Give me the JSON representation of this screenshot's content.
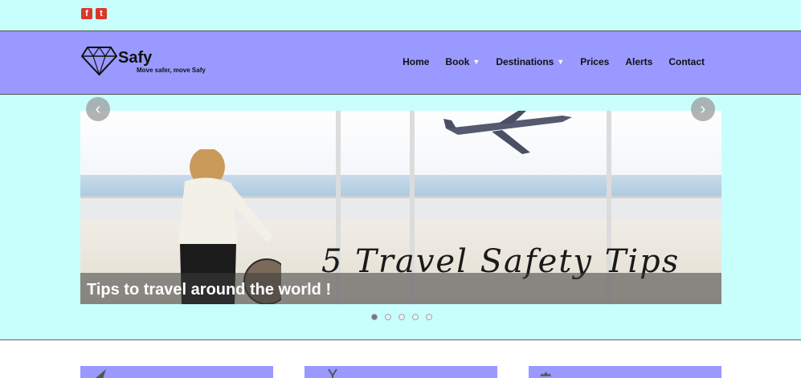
{
  "social": {
    "facebook_glyph": "f",
    "twitter_glyph": "t"
  },
  "brand": {
    "name": "Safy",
    "tagline": "Move safer, move Safy",
    "icon": "diamond-icon"
  },
  "nav": {
    "items": [
      {
        "label": "Home",
        "dropdown": false
      },
      {
        "label": "Book",
        "dropdown": true
      },
      {
        "label": "Destinations",
        "dropdown": true
      },
      {
        "label": "Prices",
        "dropdown": false
      },
      {
        "label": "Alerts",
        "dropdown": false
      },
      {
        "label": "Contact",
        "dropdown": false
      }
    ],
    "caret": "▼"
  },
  "slider": {
    "image_text": "5 Travel Safety Tips",
    "caption": "Tips to travel around the world !",
    "prev_glyph": "‹",
    "next_glyph": "›",
    "slide_count": 5,
    "active_slide": 1
  },
  "colors": {
    "background": "#c8fffd",
    "header": "#9999ff",
    "social": "#d9392b"
  }
}
